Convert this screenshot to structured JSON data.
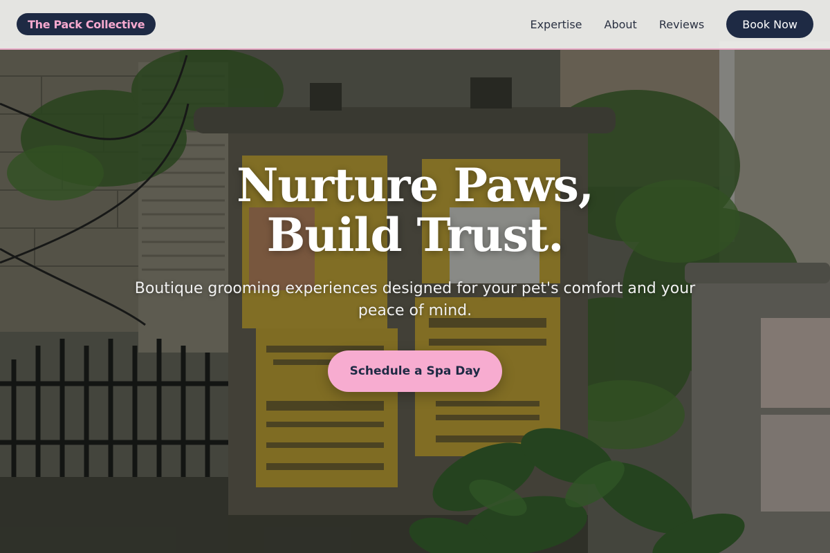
{
  "header": {
    "brand": "The Pack Collective",
    "nav": [
      "Expertise",
      "About",
      "Reviews"
    ],
    "cta_label": "Book Now"
  },
  "hero": {
    "title": "Nurture Paws, Build Trust.",
    "subtitle": "Boutique grooming experiences designed for your pet's comfort and your peace of mind.",
    "cta_label": "Schedule a Spa Day",
    "background_icon": "street-utility-box-photo"
  },
  "colors": {
    "brand_navy": "#1e2a44",
    "accent_pink": "#f7acd0",
    "header_bg": "#f0f0ee"
  }
}
